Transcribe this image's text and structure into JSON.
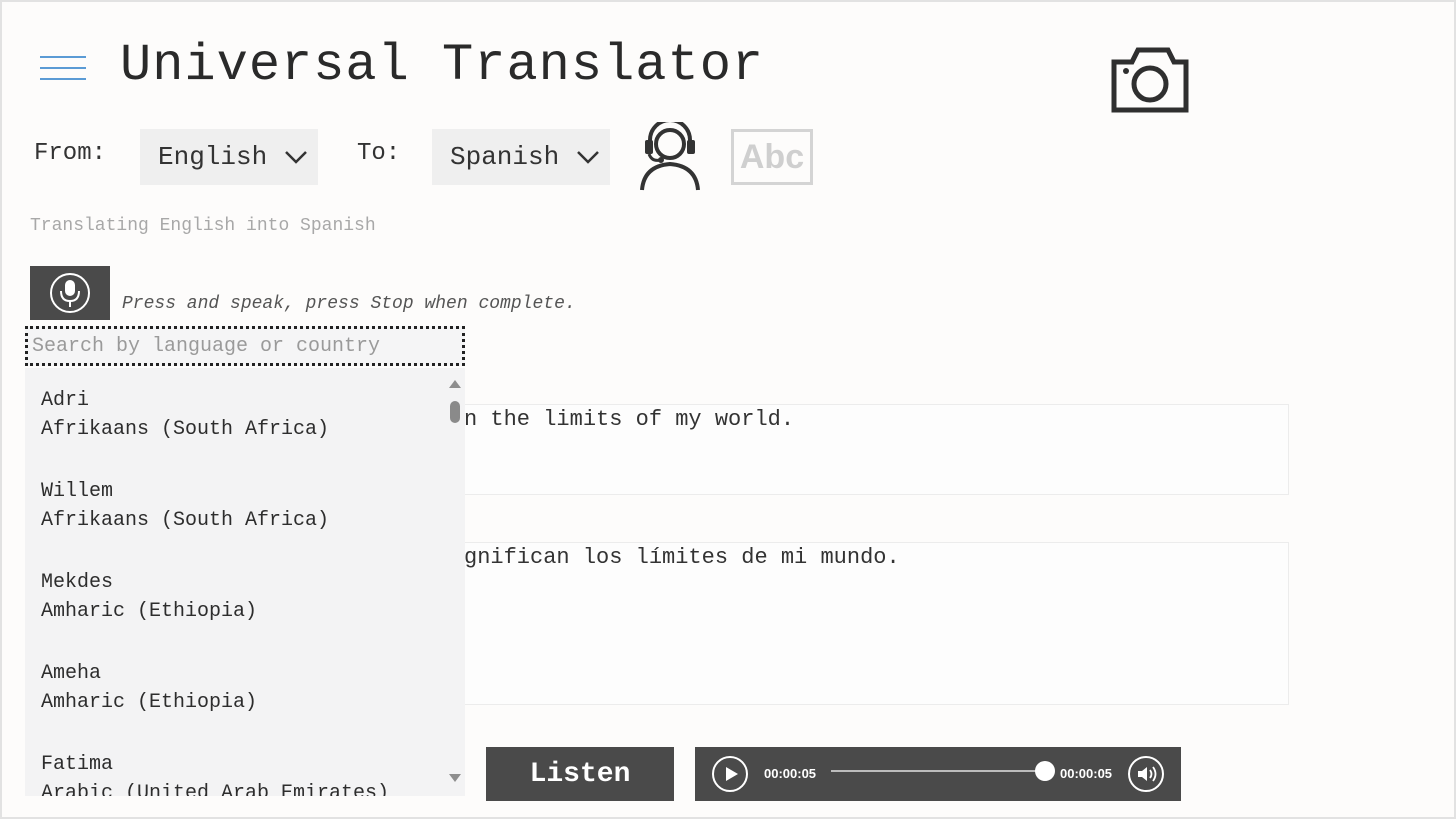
{
  "header": {
    "title": "Universal Translator",
    "menu_icon": "hamburger-menu-icon",
    "camera_icon": "camera-icon"
  },
  "languages": {
    "from_label": "From:",
    "from_value": "English",
    "to_label": "To:",
    "to_value": "Spanish",
    "agent_icon": "headset-agent-icon",
    "text_icon": "abc-text-icon",
    "text_icon_label": "Abc"
  },
  "status": {
    "message": "Translating English into Spanish"
  },
  "speech": {
    "mic_icon": "microphone-icon",
    "hint": "Press and speak, press Stop when complete."
  },
  "source": {
    "text": "n the limits of my world."
  },
  "target": {
    "text": "gnifican los límites de mi mundo."
  },
  "voice_picker": {
    "search_placeholder": "Search by language or country",
    "search_value": "",
    "items": [
      {
        "name": "Adri",
        "locale": "Afrikaans (South Africa)"
      },
      {
        "name": "Willem",
        "locale": "Afrikaans (South Africa)"
      },
      {
        "name": "Mekdes",
        "locale": "Amharic (Ethiopia)"
      },
      {
        "name": "Ameha",
        "locale": "Amharic (Ethiopia)"
      },
      {
        "name": "Fatima",
        "locale": "Arabic (United Arab Emirates)"
      }
    ],
    "scroll_position": 0.02
  },
  "player": {
    "listen_label": "Listen",
    "current_time": "00:00:05",
    "total_time": "00:00:05",
    "progress": 1.0,
    "play_icon": "play-icon",
    "volume_icon": "volume-icon"
  },
  "colors": {
    "accent": "#5b9bd5",
    "dark_button": "#4a4a4a",
    "dropdown_bg": "#f3f3f4"
  }
}
